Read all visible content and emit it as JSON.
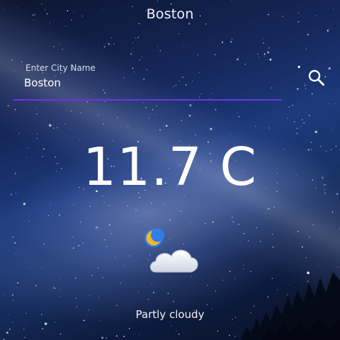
{
  "header": {
    "city_title": "Boston"
  },
  "search": {
    "label": "Enter City Name",
    "value": "Boston",
    "underline_color": "#6a34e6",
    "icon": "search-icon"
  },
  "weather": {
    "temperature": "11.7 C",
    "condition": "Partly cloudy",
    "icon": "partly-cloudy-night-icon"
  }
}
